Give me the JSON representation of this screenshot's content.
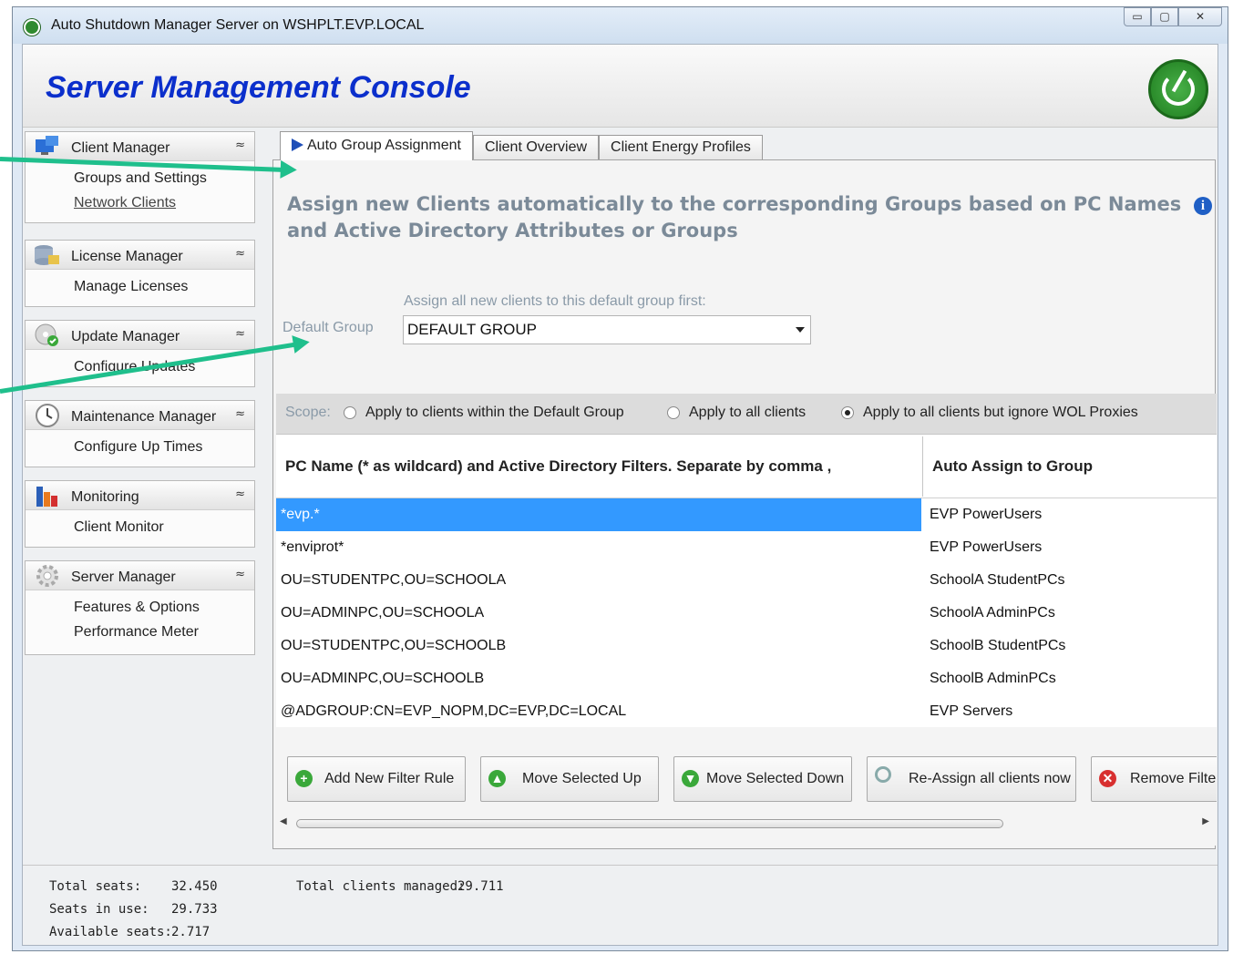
{
  "window": {
    "title": "Auto Shutdown Manager Server on WSHPLT.EVP.LOCAL",
    "min": "▭",
    "max": "▢",
    "close": "✕"
  },
  "header": {
    "title": "Server Management Console"
  },
  "sidebar": {
    "panels": [
      {
        "label": "Client Manager",
        "icon": "client-manager-icon",
        "items": [
          {
            "label": "Groups and Settings"
          },
          {
            "label": "Network Clients"
          }
        ]
      },
      {
        "label": "License Manager",
        "icon": "license-manager-icon",
        "items": [
          {
            "label": "Manage Licenses"
          }
        ]
      },
      {
        "label": "Update  Manager",
        "icon": "update-manager-icon",
        "items": [
          {
            "label": "Configure Updates"
          }
        ]
      },
      {
        "label": "Maintenance Manager",
        "icon": "maintenance-clock-icon",
        "items": [
          {
            "label": "Configure Up Times"
          }
        ]
      },
      {
        "label": "Monitoring",
        "icon": "monitoring-chart-icon",
        "items": [
          {
            "label": "Client Monitor"
          }
        ]
      },
      {
        "label": "Server Manager",
        "icon": "server-gear-icon",
        "items": [
          {
            "label": "Features & Options"
          },
          {
            "label": "Performance Meter"
          }
        ]
      }
    ],
    "chevron": "≈"
  },
  "tabs": [
    {
      "label": "Auto Group Assignment"
    },
    {
      "label": "Client Overview"
    },
    {
      "label": "Client Energy Profiles"
    }
  ],
  "main": {
    "headline": "Assign new Clients automatically to the corresponding Groups based on PC Names and Active Directory Attributes or Groups",
    "info": "i",
    "default_hint": "Assign all new clients to this default group first:",
    "default_label": "Default Group",
    "default_value": "DEFAULT GROUP",
    "scope": {
      "label": "Scope:",
      "options": [
        "Apply to clients within the Default Group",
        "Apply to all clients",
        "Apply to all clients but  ignore WOL Proxies"
      ],
      "selected_index": 2
    },
    "grid": {
      "col1": "PC Name (* as wildcard) and Active Directory Filters. Separate by comma ,",
      "col2": "Auto Assign to Group",
      "rows": [
        {
          "filter": "*evp.*",
          "group": "EVP PowerUsers"
        },
        {
          "filter": "*enviprot*",
          "group": "EVP PowerUsers"
        },
        {
          "filter": "OU=STUDENTPC,OU=SCHOOLA",
          "group": "SchoolA StudentPCs"
        },
        {
          "filter": "OU=ADMINPC,OU=SCHOOLA",
          "group": "SchoolA AdminPCs"
        },
        {
          "filter": "OU=STUDENTPC,OU=SCHOOLB",
          "group": "SchoolB StudentPCs"
        },
        {
          "filter": "OU=ADMINPC,OU=SCHOOLB",
          "group": "SchoolB AdminPCs"
        },
        {
          "filter": "@ADGROUP:CN=EVP_NOPM,DC=EVP,DC=LOCAL",
          "group": "EVP Servers"
        }
      ],
      "selected_row": 0
    },
    "buttons": {
      "add": "Add New Filter Rule",
      "up": "Move Selected Up",
      "down": "Move Selected Down",
      "reassign": "Re-Assign all clients now",
      "remove": "Remove Filter"
    }
  },
  "status": {
    "total_seats_label": "Total seats:",
    "total_seats": "32.450",
    "seats_in_use_label": "Seats in use:",
    "seats_in_use": "29.733",
    "available_label": "Available seats:",
    "available": "2.717",
    "clients_label": "Total clients managed:",
    "clients": "29.711"
  },
  "colors": {
    "brand": "#0b2fcc",
    "selection": "#3399ff",
    "annotation_arrow": "#1fbf8c"
  }
}
